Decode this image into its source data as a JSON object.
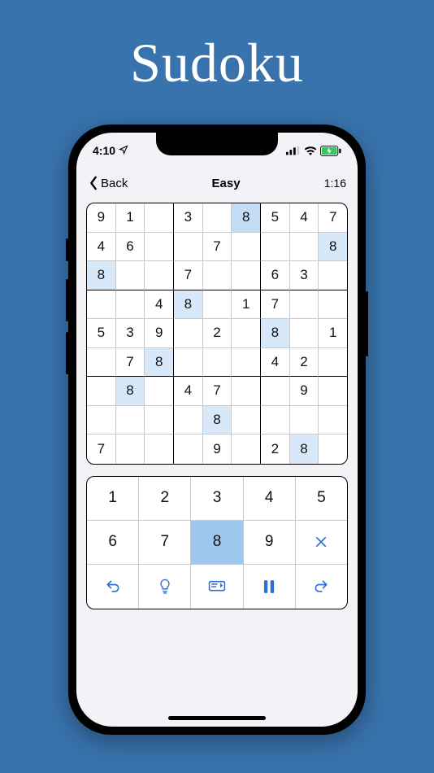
{
  "app_title": "Sudoku",
  "status": {
    "time": "4:10",
    "location_icon": "location-arrow",
    "signal_icon": "cellular-signal",
    "wifi_icon": "wifi",
    "battery_icon": "battery-charging"
  },
  "nav": {
    "back_label": "Back",
    "title": "Easy",
    "timer": "1:16"
  },
  "selected_digit": 8,
  "board": [
    [
      "9",
      "1",
      "",
      "3",
      "",
      "8",
      "5",
      "4",
      "7"
    ],
    [
      "4",
      "6",
      "",
      "",
      "7",
      "",
      "",
      "",
      "8"
    ],
    [
      "8",
      "",
      "",
      "7",
      "",
      "",
      "6",
      "3",
      ""
    ],
    [
      "",
      "",
      "4",
      "8",
      "",
      "1",
      "7",
      "",
      ""
    ],
    [
      "5",
      "3",
      "9",
      "",
      "2",
      "",
      "8",
      "",
      "1"
    ],
    [
      "",
      "7",
      "8",
      "",
      "",
      "",
      "4",
      "2",
      ""
    ],
    [
      "",
      "8",
      "",
      "4",
      "7",
      "",
      "",
      "9",
      ""
    ],
    [
      "",
      "",
      "",
      "",
      "8",
      "",
      "",
      "",
      ""
    ],
    [
      "7",
      "",
      "",
      "",
      "9",
      "",
      "2",
      "8",
      ""
    ]
  ],
  "board_highlight_light": [
    [
      0,
      5
    ],
    [
      1,
      8
    ],
    [
      2,
      0
    ],
    [
      3,
      3
    ],
    [
      4,
      6
    ],
    [
      5,
      2
    ],
    [
      6,
      1
    ],
    [
      7,
      4
    ],
    [
      8,
      7
    ]
  ],
  "board_highlight_selected": [
    0,
    5
  ],
  "numpad": {
    "digits": [
      "1",
      "2",
      "3",
      "4",
      "5",
      "6",
      "7",
      "8",
      "9"
    ],
    "clear_icon": "clear-x",
    "selected_index": 7
  },
  "toolbar": {
    "undo_icon": "undo",
    "hint_icon": "hint",
    "notes_icon": "notes",
    "pause_icon": "pause",
    "redo_icon": "redo"
  },
  "colors": {
    "bg": "#3873ad",
    "hl_light": "#d7e8f9",
    "hl_selected": "#9ec7ee",
    "accent": "#2f6fd1"
  }
}
